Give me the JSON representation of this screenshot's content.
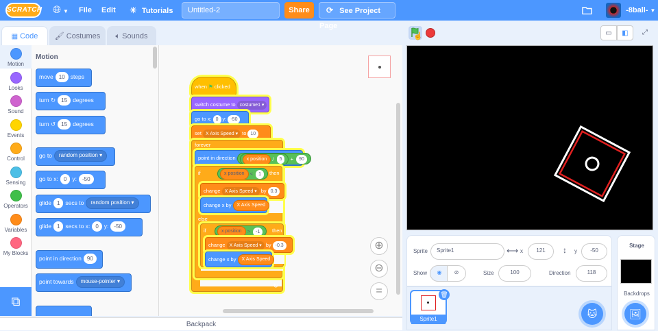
{
  "menubar": {
    "logo": "SCRATCH",
    "file": "File",
    "edit": "Edit",
    "tutorials": "Tutorials",
    "project_title": "Untitled-2",
    "share": "Share",
    "see_project_page": "See Project Page",
    "username": "-8ball-"
  },
  "tabs": {
    "code": "Code",
    "costumes": "Costumes",
    "sounds": "Sounds"
  },
  "categories": [
    {
      "label": "Motion",
      "color": "#4c97ff"
    },
    {
      "label": "Looks",
      "color": "#9966ff"
    },
    {
      "label": "Sound",
      "color": "#cf63cf"
    },
    {
      "label": "Events",
      "color": "#ffd500"
    },
    {
      "label": "Control",
      "color": "#ffab19"
    },
    {
      "label": "Sensing",
      "color": "#4cbfe6"
    },
    {
      "label": "Operators",
      "color": "#40bf4a"
    },
    {
      "label": "Variables",
      "color": "#ff8c1a"
    },
    {
      "label": "My Blocks",
      "color": "#ff6680"
    }
  ],
  "palette": {
    "heading": "Motion",
    "move": "move",
    "move_val": "10",
    "steps": "steps",
    "turn": "turn",
    "turn_right_val": "15",
    "degrees": "degrees",
    "turn_left_val": "15",
    "goto": "go to",
    "random_position": "random position",
    "goto_x": "go to x:",
    "x_val": "0",
    "y_label": "y:",
    "y_val": "-50",
    "glide": "glide",
    "glide_val": "1",
    "secs_to": "secs to",
    "secs_to_x": "secs to x:",
    "point_in_direction": "point in direction",
    "direction_val": "90",
    "point_towards": "point towards",
    "mouse_pointer": "mouse-pointer"
  },
  "script": {
    "when": "when",
    "clicked": "clicked",
    "switch_costume": "switch costume to",
    "costume": "costume1",
    "goto_x": "go to x:",
    "goto_x_val": "0",
    "goto_y": "y:",
    "goto_y_val": "-50",
    "set": "set",
    "var_name": "X Axis Speed",
    "to": "to",
    "set_val": "10",
    "forever": "forever",
    "point_dir": "point in direction",
    "x_position": "x position",
    "div": "/",
    "div_val": "5",
    "plus": "+",
    "plus_val": "90",
    "if": "if",
    "lt": "<",
    "lt_val": "1",
    "then": "then",
    "change": "change",
    "by": "by",
    "change_val1": "0.3",
    "change_x_by": "change x by",
    "else": "else",
    "gt": ">",
    "gt_val": "-1",
    "change_val2": "-0.3"
  },
  "sprite": {
    "sprite_label": "Sprite",
    "sprite_name": "Sprite1",
    "x_label": "x",
    "x_val": "121",
    "y_label": "y",
    "y_val": "-50",
    "show_label": "Show",
    "size_label": "Size",
    "size_val": "100",
    "direction_label": "Direction",
    "direction_val": "118",
    "thumb_name": "Sprite1"
  },
  "stage_panel": {
    "title": "Stage",
    "backdrops": "Backdrops"
  },
  "backpack": "Backpack",
  "colors": {
    "accent": "#4c97ff",
    "share": "#ff8c1a",
    "stop": "#ec3a3a"
  }
}
